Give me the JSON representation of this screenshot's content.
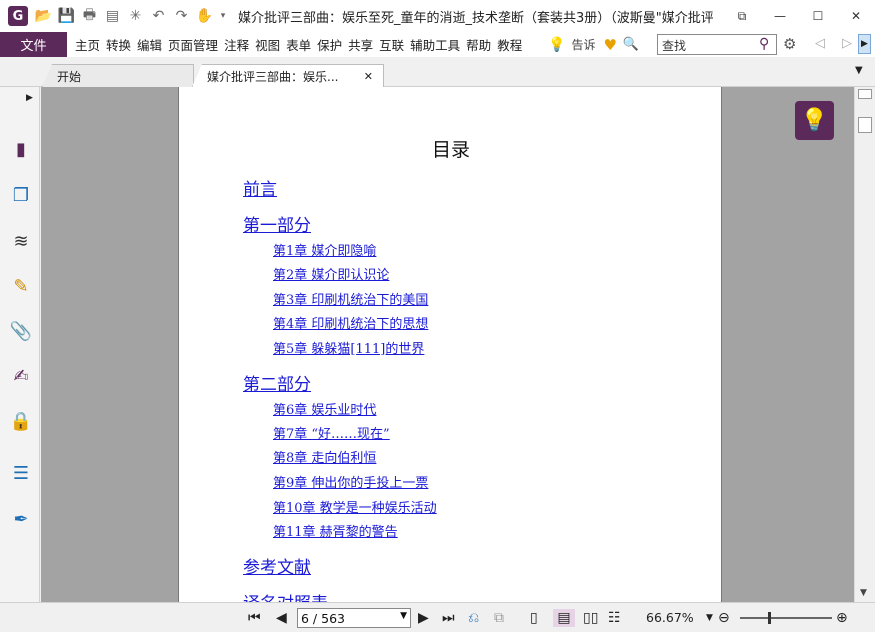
{
  "app": {
    "logo": "G",
    "title": "媒介批评三部曲：娱乐至死_童年的消逝_技术垄断（套装共3册）（波斯曼\"媒介批评三..."
  },
  "window": {
    "minimize": "—",
    "maximize": "☐",
    "close": "✕",
    "restore_small": "⧉"
  },
  "menu": {
    "file": "文件",
    "items": [
      "主页",
      "转换",
      "编辑",
      "页面管理",
      "注释",
      "视图",
      "表单",
      "保护",
      "共享",
      "互联",
      "辅助工具",
      "帮助",
      "教程"
    ],
    "tell_me": "告诉",
    "search_placeholder": "查找"
  },
  "tabs": [
    {
      "label": "开始"
    },
    {
      "label": "媒介批评三部曲：娱乐...",
      "close": "✕"
    }
  ],
  "document": {
    "toc_title": "目录",
    "entries": [
      {
        "level": 1,
        "text": "前言"
      },
      {
        "level": 1,
        "text": "第一部分"
      },
      {
        "level": 2,
        "text": "第1章 媒介即隐喻"
      },
      {
        "level": 2,
        "text": "第2章 媒介即认识论"
      },
      {
        "level": 2,
        "text": "第3章 印刷机统治下的美国"
      },
      {
        "level": 2,
        "text": "第4章 印刷机统治下的思想"
      },
      {
        "level": 2,
        "text": "第5章 躲躲猫[111]的世界"
      },
      {
        "level": 1,
        "text": "第二部分"
      },
      {
        "level": 2,
        "text": "第6章 娱乐业时代"
      },
      {
        "level": 2,
        "text": "第7章 “好……现在”"
      },
      {
        "level": 2,
        "text": "第8章 走向伯利恒"
      },
      {
        "level": 2,
        "text": "第9章 伸出你的手投上一票"
      },
      {
        "level": 2,
        "text": "第10章 教学是一种娱乐活动"
      },
      {
        "level": 2,
        "text": "第11章 赫胥黎的警告"
      },
      {
        "level": 1,
        "text": "参考文献"
      },
      {
        "level": 1,
        "text": "译名对照表"
      }
    ]
  },
  "status": {
    "page_indicator": "6 / 563",
    "zoom": "66.67%"
  },
  "colors": {
    "brand": "#5c2a5a",
    "link": "#1b1bd6"
  }
}
